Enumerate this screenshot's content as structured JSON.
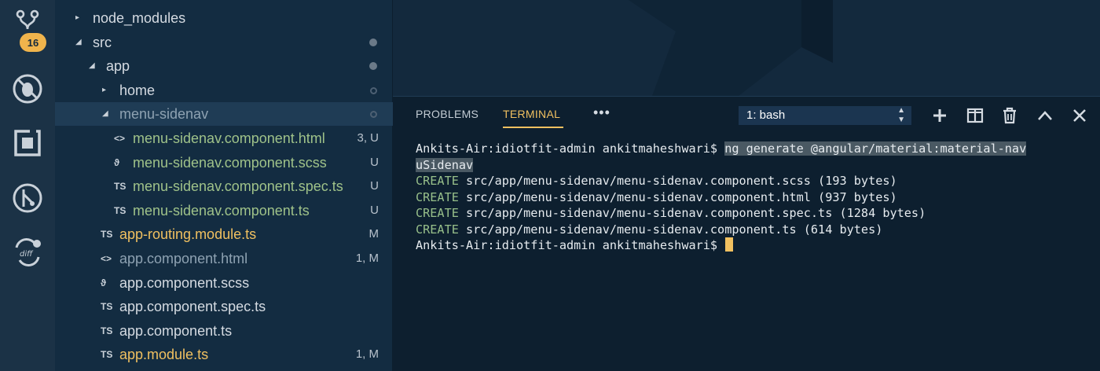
{
  "activity_bar": {
    "scm_badge": "16",
    "icons": [
      "source-control-icon",
      "debug-icon",
      "extensions-icon",
      "gitlens-icon",
      "diff-icon"
    ]
  },
  "explorer": {
    "rows": [
      {
        "label": "node_modules",
        "twisty": "▸",
        "icon": "",
        "status": "",
        "dot": ""
      },
      {
        "label": "src",
        "twisty": "◢",
        "icon": "",
        "status": "",
        "dot": "filled"
      },
      {
        "label": "app",
        "twisty": "◢",
        "icon": "",
        "status": "",
        "dot": "filled"
      },
      {
        "label": "home",
        "twisty": "▸",
        "icon": "",
        "status": "",
        "dot": "hollow"
      },
      {
        "label": "menu-sidenav",
        "twisty": "◢",
        "icon": "",
        "status": "",
        "dot": "hollow"
      },
      {
        "label": "menu-sidenav.component.html",
        "twisty": "",
        "icon": "<>",
        "status": "3, U",
        "dot": ""
      },
      {
        "label": "menu-sidenav.component.scss",
        "twisty": "",
        "icon": "ϑ",
        "status": "U",
        "dot": ""
      },
      {
        "label": "menu-sidenav.component.spec.ts",
        "twisty": "",
        "icon": "TS",
        "status": "U",
        "dot": ""
      },
      {
        "label": "menu-sidenav.component.ts",
        "twisty": "",
        "icon": "TS",
        "status": "U",
        "dot": ""
      },
      {
        "label": "app-routing.module.ts",
        "twisty": "",
        "icon": "TS",
        "status": "M",
        "dot": ""
      },
      {
        "label": "app.component.html",
        "twisty": "",
        "icon": "<>",
        "status": "1, M",
        "dot": ""
      },
      {
        "label": "app.component.scss",
        "twisty": "",
        "icon": "ϑ",
        "status": "",
        "dot": ""
      },
      {
        "label": "app.component.spec.ts",
        "twisty": "",
        "icon": "TS",
        "status": "",
        "dot": ""
      },
      {
        "label": "app.component.ts",
        "twisty": "",
        "icon": "TS",
        "status": "",
        "dot": ""
      },
      {
        "label": "app.module.ts",
        "twisty": "",
        "icon": "TS",
        "status": "1, M",
        "dot": ""
      }
    ]
  },
  "panel": {
    "tabs": [
      {
        "label": "PROBLEMS",
        "active": false
      },
      {
        "label": "TERMINAL",
        "active": true
      }
    ],
    "more_label": "•••",
    "terminal_select": "1: bash",
    "terminal_lines": [
      {
        "prompt": "Ankits-Air:idiotfit-admin ankitmaheshwari$ ",
        "command": "ng generate @angular/material:material-nav"
      },
      {
        "prompt": "",
        "command": "uSidenav"
      },
      {
        "create": "CREATE",
        "text": " src/app/menu-sidenav/menu-sidenav.component.scss (193 bytes)"
      },
      {
        "create": "CREATE",
        "text": " src/app/menu-sidenav/menu-sidenav.component.html (937 bytes)"
      },
      {
        "create": "CREATE",
        "text": " src/app/menu-sidenav/menu-sidenav.component.spec.ts (1284 bytes)"
      },
      {
        "create": "CREATE",
        "text": " src/app/menu-sidenav/menu-sidenav.component.ts (614 bytes)"
      },
      {
        "prompt": "Ankits-Air:idiotfit-admin ankitmaheshwari$ ",
        "cursor": true
      }
    ]
  },
  "colors": {
    "accent": "#f0c060",
    "create_green": "#97bf8a",
    "untracked_green": "#9fc289",
    "modified_yellow": "#f0c060",
    "panel_bg": "#0d1f2f",
    "sidebar_bg": "#132c41"
  }
}
